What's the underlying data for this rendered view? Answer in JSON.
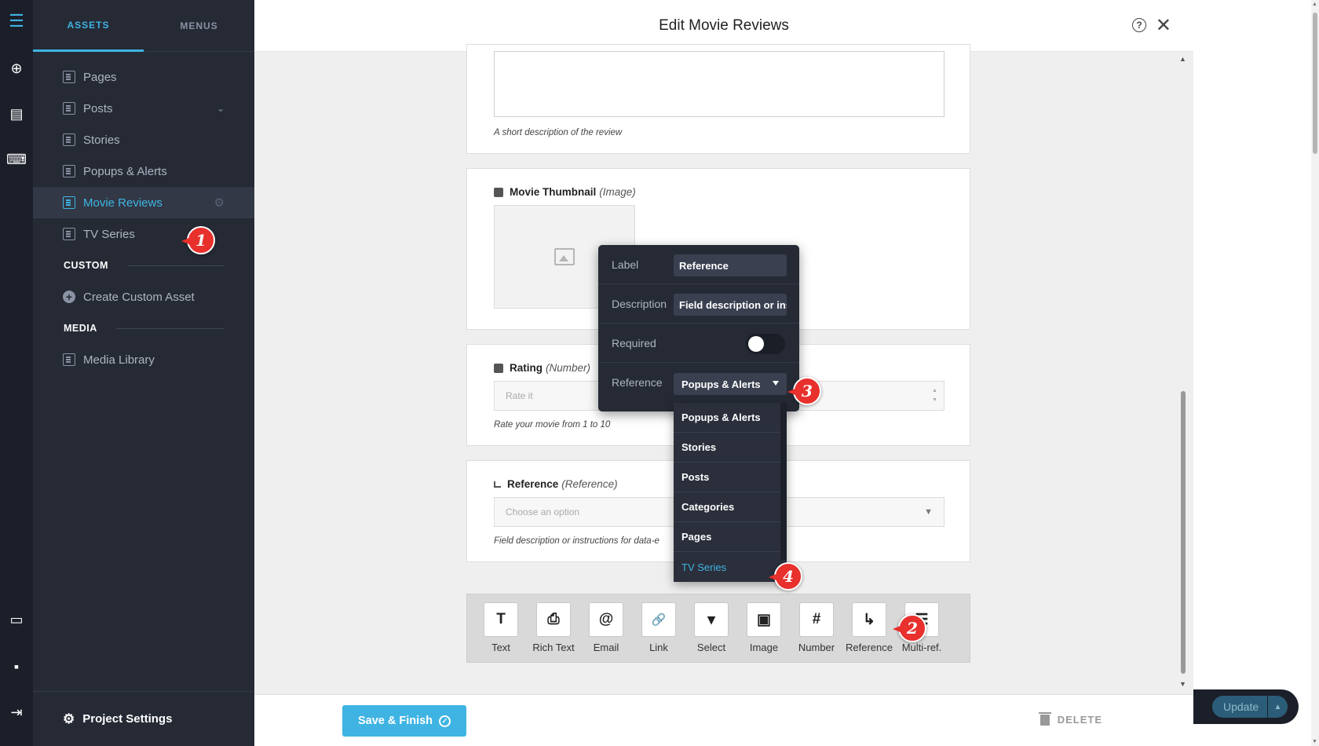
{
  "rail": {
    "icons": [
      "hamburger-menu-icon",
      "add-circle-icon",
      "layers-icon",
      "brush-icon",
      "monitor-icon",
      "note-icon",
      "logout-icon"
    ]
  },
  "sidebar": {
    "tabs": [
      "ASSETS",
      "MENUS"
    ],
    "active_tab": "ASSETS",
    "items": [
      {
        "label": "Pages"
      },
      {
        "label": "Posts"
      },
      {
        "label": "Stories"
      },
      {
        "label": "Popups & Alerts"
      },
      {
        "label": "Movie Reviews",
        "active": true
      },
      {
        "label": "TV Series"
      }
    ],
    "custom_heading": "CUSTOM",
    "custom_item": "Create Custom Asset",
    "media_heading": "MEDIA",
    "media_item": "Media Library",
    "project_settings": "Project Settings"
  },
  "modal": {
    "title": "Edit Movie Reviews",
    "help_glyph": "?",
    "close_glyph": "✕",
    "description_help": "A short description of the review",
    "thumbnail": {
      "name": "Movie Thumbnail",
      "type": "(Image)"
    },
    "rating": {
      "name": "Rating",
      "type": "(Number)",
      "placeholder": "Rate it",
      "help": "Rate your movie from 1 to 10"
    },
    "reference": {
      "name": "Reference",
      "type": "(Reference)",
      "placeholder": "Choose an option",
      "help": "Field description or instructions for data-e"
    }
  },
  "popover": {
    "label_label": "Label",
    "label_value": "Reference",
    "description_label": "Description",
    "description_value": "Field description or instructions for data-entry",
    "required_label": "Required",
    "required_on": false,
    "reference_label": "Reference",
    "reference_value": "Popups & Alerts"
  },
  "dropdown": {
    "options": [
      "Popups & Alerts",
      "Stories",
      "Posts",
      "Categories",
      "Pages",
      "TV Series"
    ],
    "selected": "TV Series"
  },
  "toolbar": {
    "tools": [
      {
        "label": "Text",
        "glyph": "T"
      },
      {
        "label": "Rich Text",
        "glyph": "⎙"
      },
      {
        "label": "Email",
        "glyph": "@"
      },
      {
        "label": "Link",
        "glyph": "🔗"
      },
      {
        "label": "Select",
        "glyph": "▾"
      },
      {
        "label": "Image",
        "glyph": "▣"
      },
      {
        "label": "Number",
        "glyph": "#"
      },
      {
        "label": "Reference",
        "glyph": "↳"
      },
      {
        "label": "Multi-ref.",
        "glyph": "☰"
      }
    ]
  },
  "footer": {
    "save_label": "Save & Finish",
    "delete_label": "DELETE"
  },
  "right": {
    "update_label": "Update"
  },
  "annotations": [
    "1",
    "2",
    "3",
    "4"
  ],
  "colors": {
    "accent": "#3fb4e3",
    "sidebar": "#252a35",
    "rail": "#1b1f29",
    "badge": "#e8302c"
  }
}
